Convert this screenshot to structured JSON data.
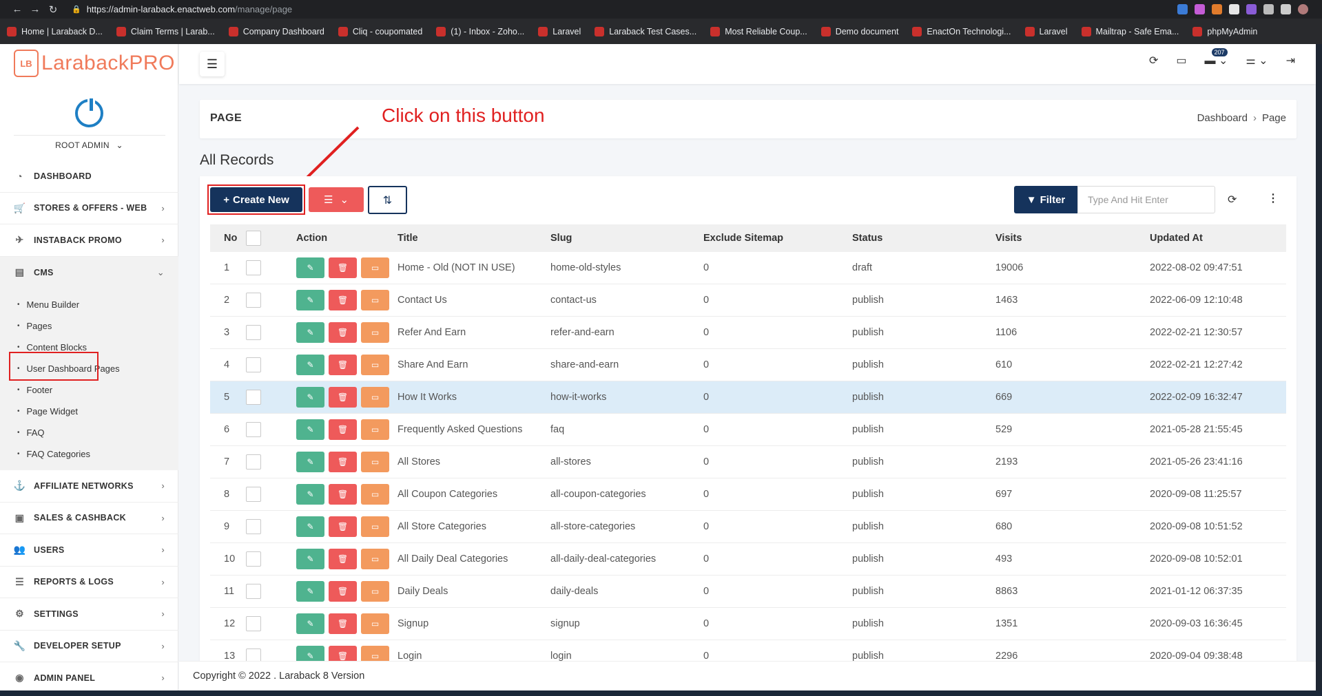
{
  "browser": {
    "url_host": "https://admin-laraback.enactweb.com",
    "url_path": "/manage/page",
    "bookmarks": [
      "Home | Laraback D...",
      "Claim Terms | Larab...",
      "Company Dashboard",
      "Cliq - coupomated",
      "(1) - Inbox - Zoho...",
      "Laravel",
      "Laraback Test Cases...",
      "Most Reliable Coup...",
      "Demo document",
      "EnactOn Technologi...",
      "Laravel",
      "Mailtrap - Safe Ema...",
      "phpMyAdmin"
    ]
  },
  "sidebar": {
    "logo_mark": "LB",
    "brand": "LarabackPRO",
    "user": "ROOT ADMIN",
    "items": [
      {
        "label": "DASHBOARD",
        "icon": "dashboard-icon",
        "glyph": "◔"
      },
      {
        "label": "STORES & OFFERS - WEB",
        "icon": "cart-icon",
        "glyph": "🛒"
      },
      {
        "label": "INSTABACK PROMO",
        "icon": "plane-icon",
        "glyph": "✈"
      },
      {
        "label": "CMS",
        "icon": "cms-icon",
        "glyph": "▤"
      },
      {
        "label": "AFFILIATE NETWORKS",
        "icon": "anchor-icon",
        "glyph": "⚓"
      },
      {
        "label": "SALES & CASHBACK",
        "icon": "money-icon",
        "glyph": "▣"
      },
      {
        "label": "USERS",
        "icon": "users-icon",
        "glyph": "👥"
      },
      {
        "label": "REPORTS & LOGS",
        "icon": "list-icon",
        "glyph": "☰"
      },
      {
        "label": "SETTINGS",
        "icon": "gears-icon",
        "glyph": "⚙"
      },
      {
        "label": "DEVELOPER SETUP",
        "icon": "wrench-icon",
        "glyph": "🔧"
      },
      {
        "label": "ADMIN PANEL",
        "icon": "admin-icon",
        "glyph": "◉"
      }
    ],
    "cms_sub": [
      "Menu Builder",
      "Pages",
      "Content Blocks",
      "User Dashboard Pages",
      "Footer",
      "Page Widget",
      "FAQ",
      "FAQ Categories"
    ]
  },
  "topbar": {
    "notification_count": "207"
  },
  "page": {
    "title": "PAGE",
    "breadcrumb": [
      "Dashboard",
      "Page"
    ],
    "annotation": "Click on this button",
    "section": "All Records",
    "create_label": "Create New",
    "filter_label": "Filter",
    "search_placeholder": "Type And Hit Enter"
  },
  "table": {
    "headers": [
      "No",
      "Action",
      "Title",
      "Slug",
      "Exclude Sitemap",
      "Status",
      "Visits",
      "Updated At"
    ],
    "rows": [
      {
        "no": "1",
        "title": "Home - Old (NOT IN USE)",
        "slug": "home-old-styles",
        "ex": "0",
        "status": "draft",
        "visits": "19006",
        "updated": "2022-08-02 09:47:51"
      },
      {
        "no": "2",
        "title": "Contact Us",
        "slug": "contact-us",
        "ex": "0",
        "status": "publish",
        "visits": "1463",
        "updated": "2022-06-09 12:10:48"
      },
      {
        "no": "3",
        "title": "Refer And Earn",
        "slug": "refer-and-earn",
        "ex": "0",
        "status": "publish",
        "visits": "1106",
        "updated": "2022-02-21 12:30:57"
      },
      {
        "no": "4",
        "title": "Share And Earn",
        "slug": "share-and-earn",
        "ex": "0",
        "status": "publish",
        "visits": "610",
        "updated": "2022-02-21 12:27:42"
      },
      {
        "no": "5",
        "title": "How It Works",
        "slug": "how-it-works",
        "ex": "0",
        "status": "publish",
        "visits": "669",
        "updated": "2022-02-09 16:32:47"
      },
      {
        "no": "6",
        "title": "Frequently Asked Questions",
        "slug": "faq",
        "ex": "0",
        "status": "publish",
        "visits": "529",
        "updated": "2021-05-28 21:55:45"
      },
      {
        "no": "7",
        "title": "All Stores",
        "slug": "all-stores",
        "ex": "0",
        "status": "publish",
        "visits": "2193",
        "updated": "2021-05-26 23:41:16"
      },
      {
        "no": "8",
        "title": "All Coupon Categories",
        "slug": "all-coupon-categories",
        "ex": "0",
        "status": "publish",
        "visits": "697",
        "updated": "2020-09-08 11:25:57"
      },
      {
        "no": "9",
        "title": "All Store Categories",
        "slug": "all-store-categories",
        "ex": "0",
        "status": "publish",
        "visits": "680",
        "updated": "2020-09-08 10:51:52"
      },
      {
        "no": "10",
        "title": "All Daily Deal Categories",
        "slug": "all-daily-deal-categories",
        "ex": "0",
        "status": "publish",
        "visits": "493",
        "updated": "2020-09-08 10:52:01"
      },
      {
        "no": "11",
        "title": "Daily Deals",
        "slug": "daily-deals",
        "ex": "0",
        "status": "publish",
        "visits": "8863",
        "updated": "2021-01-12 06:37:35"
      },
      {
        "no": "12",
        "title": "Signup",
        "slug": "signup",
        "ex": "0",
        "status": "publish",
        "visits": "1351",
        "updated": "2020-09-03 16:36:45"
      },
      {
        "no": "13",
        "title": "Login",
        "slug": "login",
        "ex": "0",
        "status": "publish",
        "visits": "2296",
        "updated": "2020-09-04 09:38:48"
      }
    ]
  },
  "footer": {
    "copyright": "Copyright © 2022 . Laraback 8 Version"
  },
  "colors": {
    "primary": "#15335c",
    "danger": "#ee5a5a",
    "success": "#4fb38f",
    "warning": "#f39a5e",
    "annotation": "#e02020"
  }
}
